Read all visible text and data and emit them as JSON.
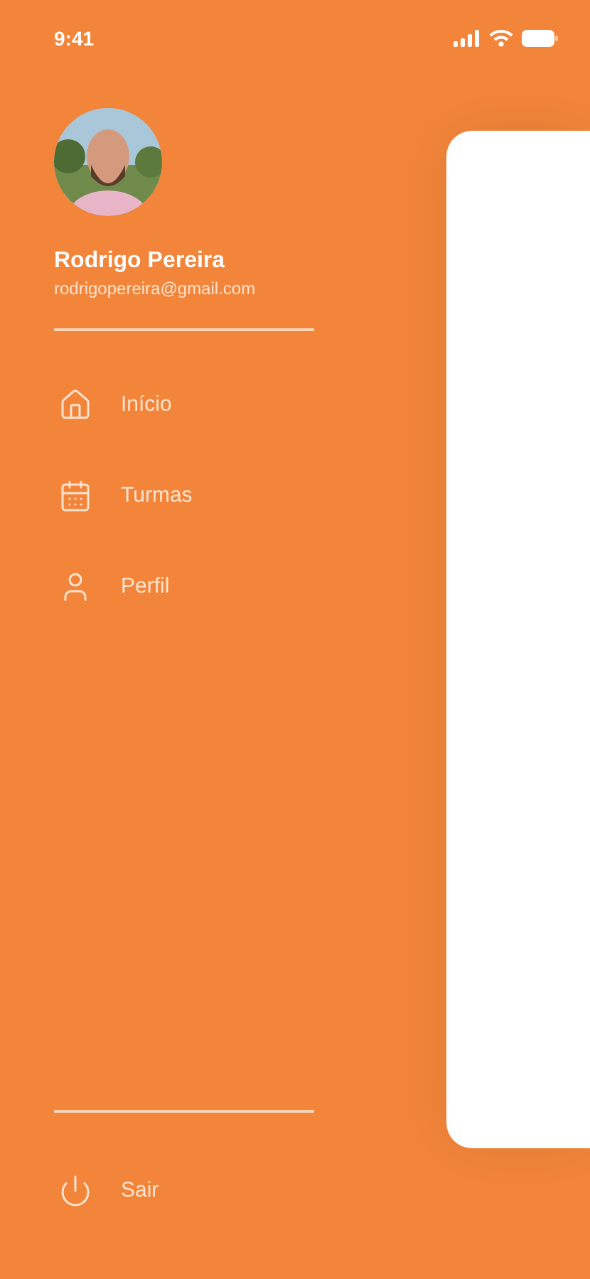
{
  "status_bar": {
    "time": "9:41"
  },
  "profile": {
    "name": "Rodrigo Pereira",
    "email": "rodrigopereira@gmail.com"
  },
  "menu": [
    {
      "label": "Início"
    },
    {
      "label": "Turmas"
    },
    {
      "label": "Perfil"
    }
  ],
  "logout": {
    "label": "Sair"
  }
}
